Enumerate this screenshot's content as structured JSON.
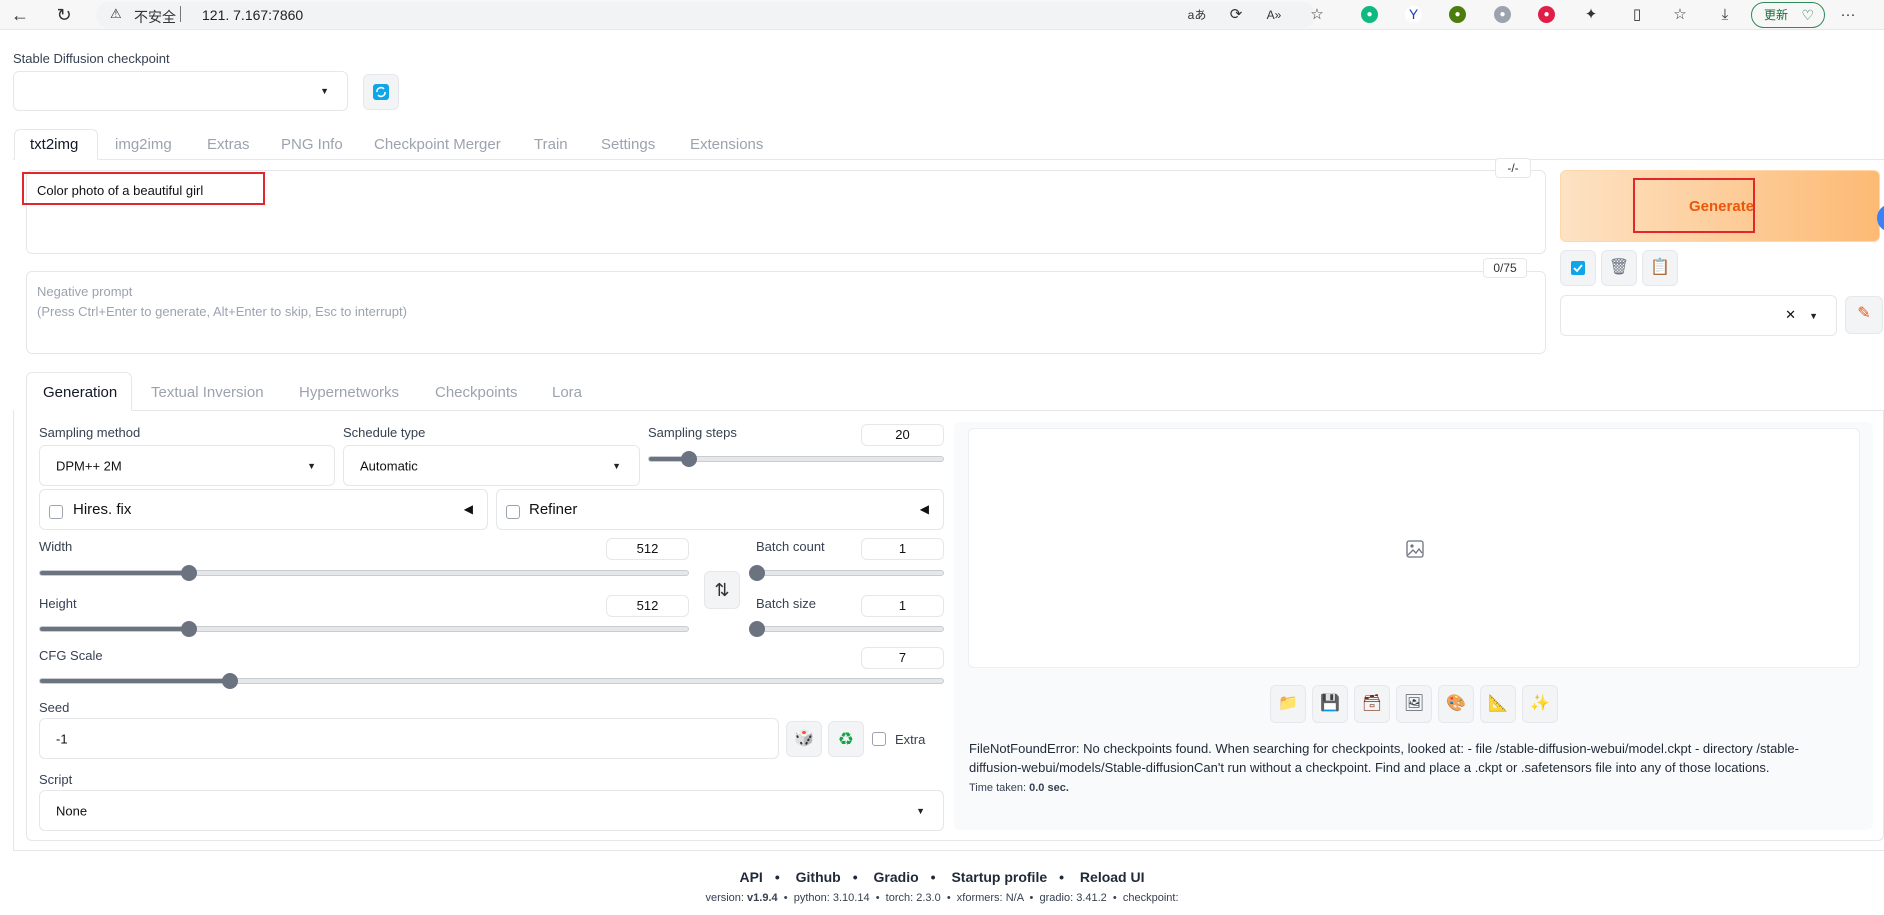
{
  "browser": {
    "insecure_label": "不安全",
    "url": "121.     7.167:7860",
    "update_label": "更新"
  },
  "checkpoint": {
    "label": "Stable Diffusion checkpoint",
    "value": ""
  },
  "tabs": [
    {
      "label": "txt2img"
    },
    {
      "label": "img2img"
    },
    {
      "label": "Extras"
    },
    {
      "label": "PNG Info"
    },
    {
      "label": "Checkpoint Merger"
    },
    {
      "label": "Train"
    },
    {
      "label": "Settings"
    },
    {
      "label": "Extensions"
    }
  ],
  "prompt": {
    "value": "Color photo of a beautiful girl",
    "token_counter": "-/-",
    "neg_token_counter": "0/75",
    "neg_placeholder_1": "Negative prompt",
    "neg_placeholder_2": "(Press Ctrl+Enter to generate, Alt+Enter to skip, Esc to interrupt)"
  },
  "generate_label": "Generate",
  "subtabs": [
    {
      "label": "Generation"
    },
    {
      "label": "Textual Inversion"
    },
    {
      "label": "Hypernetworks"
    },
    {
      "label": "Checkpoints"
    },
    {
      "label": "Lora"
    }
  ],
  "sampling": {
    "method_label": "Sampling method",
    "method_value": "DPM++ 2M",
    "schedule_label": "Schedule type",
    "schedule_value": "Automatic",
    "steps_label": "Sampling steps",
    "steps_value": "20",
    "steps_fraction": 0.135
  },
  "hires_label": "Hires. fix",
  "refiner_label": "Refiner",
  "width": {
    "label": "Width",
    "value": "512",
    "fraction": 0.23
  },
  "height": {
    "label": "Height",
    "value": "512",
    "fraction": 0.23
  },
  "batch_count": {
    "label": "Batch count",
    "value": "1",
    "fraction": 0.0
  },
  "batch_size": {
    "label": "Batch size",
    "value": "1",
    "fraction": 0.0
  },
  "cfg": {
    "label": "CFG Scale",
    "value": "7",
    "fraction": 0.21
  },
  "seed": {
    "label": "Seed",
    "value": "-1",
    "extra_label": "Extra"
  },
  "script": {
    "label": "Script",
    "value": "None"
  },
  "error": {
    "message": "FileNotFoundError: No checkpoints found. When searching for checkpoints, looked at: - file /stable-diffusion-webui/model.ckpt - directory /stable-diffusion-webui/models/Stable-diffusionCan't run without a checkpoint. Find and place a .ckpt or .safetensors file into any of those locations.",
    "time_label": "Time taken:",
    "time_value": "0.0 sec."
  },
  "footer": {
    "links": [
      "API",
      "Github",
      "Gradio",
      "Startup profile",
      "Reload UI"
    ],
    "version_label": "version:",
    "version": "v1.9.4",
    "python_label": "python:",
    "python": "3.10.14",
    "torch_label": "torch:",
    "torch": "2.3.0",
    "xformers_label": "xformers:",
    "xformers": "N/A",
    "gradio_label": "gradio:",
    "gradio": "3.41.2",
    "checkpoint_label": "checkpoint:"
  },
  "icons": [
    "back-arrow-icon",
    "refresh-icon",
    "warning-icon",
    "star-icon",
    "folder-icon",
    "save-icon",
    "zip-icon",
    "image-icon",
    "palette-icon",
    "ruler-icon",
    "sparkle-icon",
    "dice-icon",
    "recycle-icon",
    "trash-icon",
    "clipboard-icon",
    "pencil-icon",
    "swap-icon"
  ]
}
